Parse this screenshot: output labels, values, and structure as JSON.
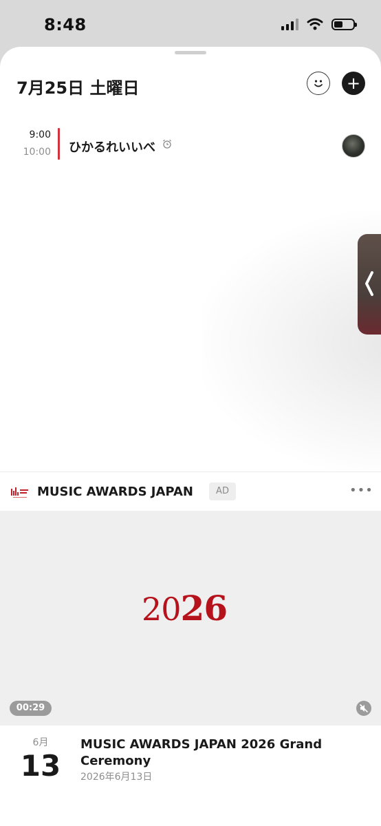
{
  "status_bar": {
    "time": "8:48",
    "battery_level": 0.45
  },
  "header": {
    "date_title": "7月25日 土曜日"
  },
  "event": {
    "start_time": "9:00",
    "end_time": "10:00",
    "title": "ひかるれいいべ",
    "accent_color": "#d2323c"
  },
  "ad": {
    "advertiser": "MUSIC AWARDS JAPAN",
    "tag": "AD",
    "more_label": "•••",
    "media_text_light": "20",
    "media_text_bold": "26",
    "duration": "00:29",
    "month": "6月",
    "day": "13",
    "title": "MUSIC AWARDS JAPAN 2026 Grand Ceremony",
    "date_text": "2026年6月13日",
    "brand_color": "#b5121b"
  },
  "icons": [
    "wifi-icon",
    "signal-icon",
    "battery-icon",
    "face-icon",
    "plus-icon",
    "alarm-icon",
    "chevron-left-icon",
    "mute-icon"
  ]
}
